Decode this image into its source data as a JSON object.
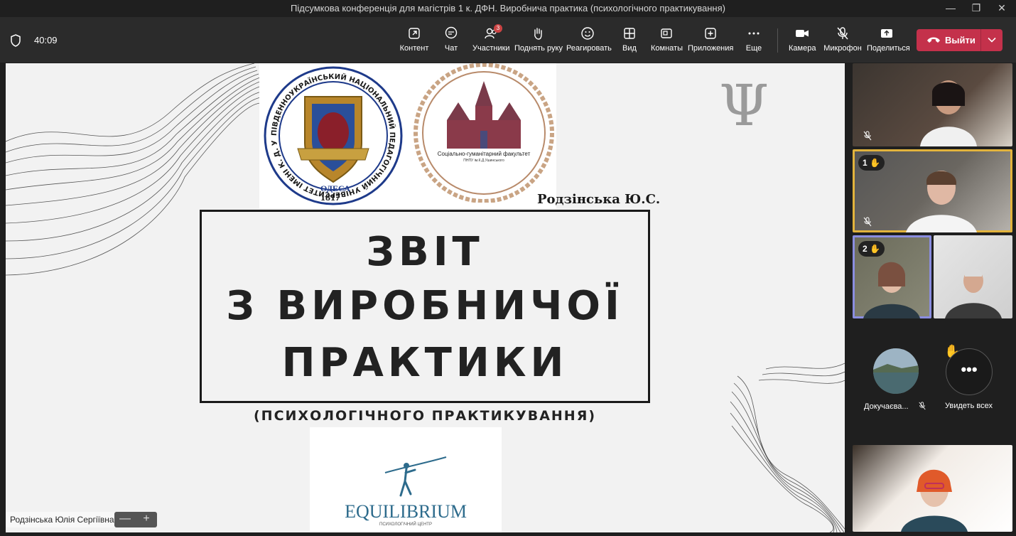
{
  "window": {
    "title": "Підсумкова конференція для магістрів 1 к. ДФН. Виробнича практика (психологічного практикування)"
  },
  "meeting": {
    "timer": "40:09"
  },
  "toolbar": {
    "content": "Контент",
    "chat": "Чат",
    "participants": "Участники",
    "participants_count": "3",
    "raise_hand": "Поднять руку",
    "react": "Реагировать",
    "view": "Вид",
    "rooms": "Комнаты",
    "apps": "Приложения",
    "more": "Еще",
    "camera": "Камера",
    "mic": "Микрофон",
    "share": "Поделиться",
    "leave": "Выйти",
    "leave_color": "#c4314b"
  },
  "slide": {
    "university_logo_text": "ПІВДЕННОУКРАЇНСЬКИЙ НАЦІОНАЛЬНИЙ ПЕДАГОГІЧНИЙ УНІВЕРСИТЕТ ІМЕНІ К. Д. УШИНСЬКОГО",
    "university_city": "ОДЕСА",
    "university_year": "1817",
    "faculty_logo_text": "Соціально-гуманітарний факультет",
    "faculty_logo_sub": "ПНПУ ім.К.Д.Ушинського",
    "psi_symbol": "Ψ",
    "author": "Родзінська Ю.С.",
    "title_line1": "ЗВІТ",
    "title_line2": "З ВИРОБНИЧОЇ",
    "title_line3": "ПРАКТИКИ",
    "subtitle": "(ПСИХОЛОГІЧНОГО ПРАКТИКУВАННЯ)",
    "equilibrium_name": "EQUILIBRIUM",
    "equilibrium_sub": "ПСИХОЛОГІЧНИЙ ЦЕНТР"
  },
  "presenter": {
    "name": "Родзінська Юлія Сергіївна",
    "zoom_minus": "—",
    "zoom_plus": "+"
  },
  "gallery": {
    "tile2_badge": "1",
    "tile3_badge": "2",
    "attendee_name": "Докучаєва...",
    "see_all": "Увидеть всех",
    "more_dots": "•••"
  }
}
